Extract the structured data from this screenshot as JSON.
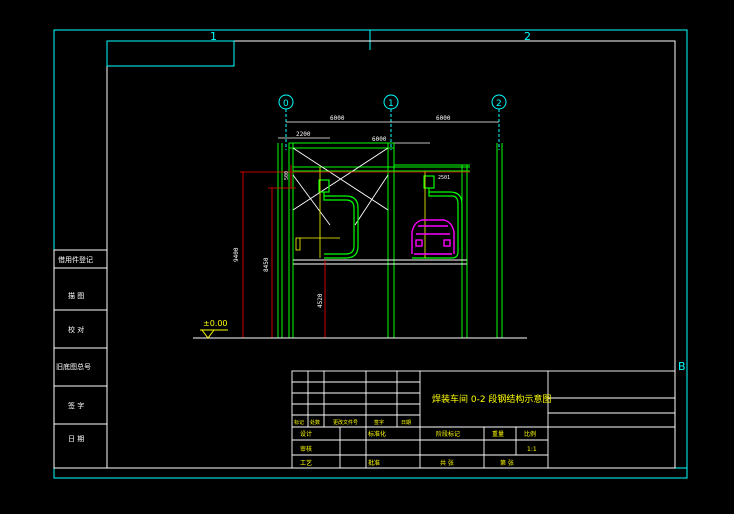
{
  "colors": {
    "background": "#000000",
    "frame": "#00ffff",
    "border": "#ffffff",
    "structure": "#00ff00",
    "dimension": "#ff0000",
    "vehicle": "#ff00ff",
    "annotation": "#ffff00",
    "text": "#ffffff"
  },
  "zone_markers": {
    "top_left": "1",
    "top_right": "2",
    "right": "B"
  },
  "grid_axes": [
    "0",
    "1",
    "2"
  ],
  "dims": {
    "span_left": "6000",
    "span_right": "6000",
    "width_2200": "2200",
    "width_6000_mid": "6000",
    "dim_2501": "2501",
    "dim_500": "500",
    "height_9400": "9400",
    "height_8450": "8450",
    "height_4520": "4520"
  },
  "level_mark": "±0.00",
  "side_table": [
    "借用件登记",
    "描 图",
    "校 对",
    "旧底图总号",
    "签 字",
    "日 期"
  ],
  "title_block": {
    "drawing_title": "焊装车间 0-2 段钢结构示意图",
    "row_labels": [
      "标记",
      "处数",
      "更改文件号",
      "签字",
      "日期"
    ],
    "design": "设计",
    "check": "审核",
    "approve": "批准",
    "process": "工艺",
    "std": "标准化",
    "stage_mark": "阶段标记",
    "weight": "重量",
    "scale": "比例",
    "scale_value": "1:1",
    "sheets": "共 张",
    "sheet_no": "第 张"
  }
}
